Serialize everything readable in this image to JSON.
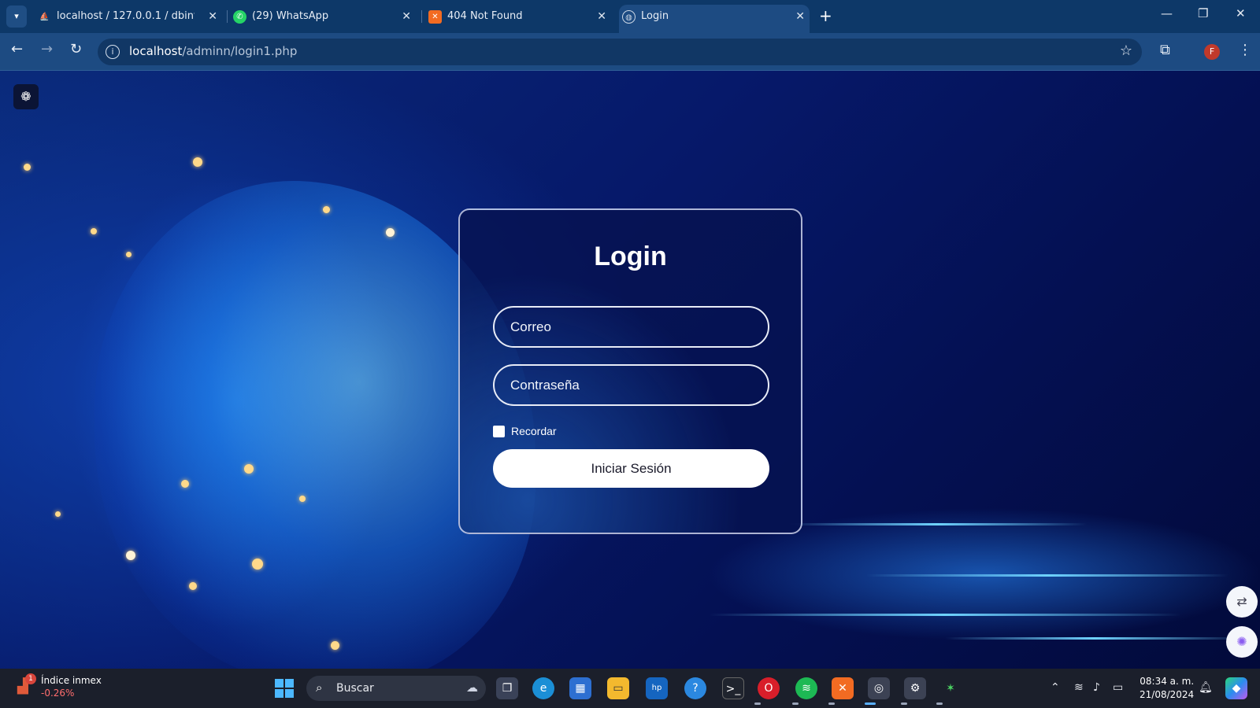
{
  "browser": {
    "tabs": [
      {
        "title": "localhost / 127.0.0.1 / dbintegra",
        "favicon": "phpmyadmin-icon"
      },
      {
        "title": "(29) WhatsApp",
        "favicon": "whatsapp-icon"
      },
      {
        "title": "404 Not Found",
        "favicon": "xampp-icon"
      },
      {
        "title": "Login",
        "favicon": "globe-icon",
        "active": true
      }
    ],
    "url_host": "localhost",
    "url_path": "/adminn/login1.php",
    "profile_initial": "F"
  },
  "page": {
    "login": {
      "title": "Login",
      "email_placeholder": "Correo",
      "password_placeholder": "Contraseña",
      "remember_label": "Recordar",
      "submit_label": "Iniciar Sesión"
    }
  },
  "taskbar": {
    "widget": {
      "title": "Índice inmex",
      "value": "-0.26%",
      "badge": "1"
    },
    "search_label": "Buscar",
    "clock": {
      "time": "08:34 a. m.",
      "date": "21/08/2024"
    }
  },
  "colors": {
    "tabstrip": "#0d3868",
    "toolbar": "#1d4b82",
    "taskbar": "#1b1f2b",
    "card_border": "#e8ecf7"
  }
}
